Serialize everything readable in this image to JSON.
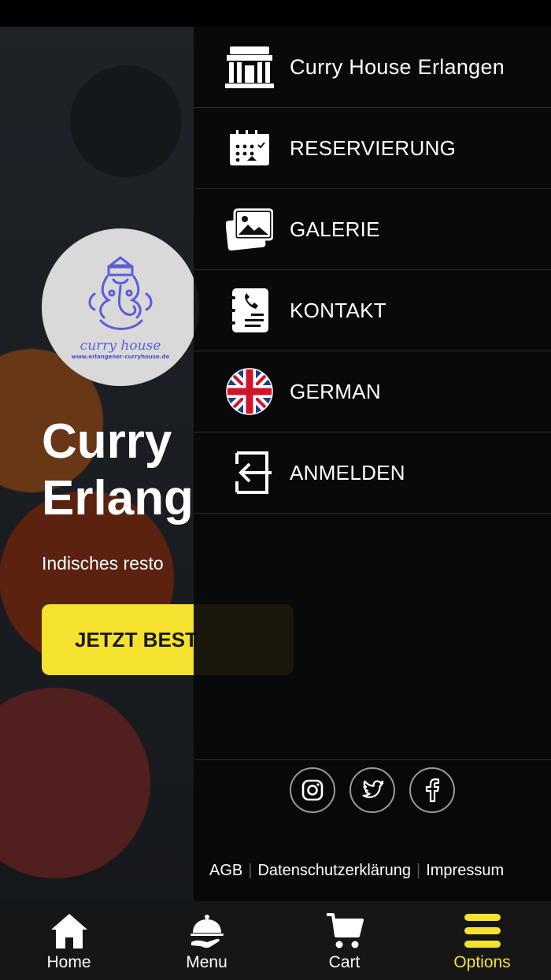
{
  "hero": {
    "title_line1": "Curry",
    "title_line2": "Erlang",
    "subtitle": "Indisches resto",
    "order_button": "JETZT BEST",
    "logo_text": "curry house",
    "logo_url": "www.erlangener-curryhouse.de"
  },
  "drawer": {
    "items": [
      {
        "label": "Curry House Erlangen",
        "icon": "restaurant-icon"
      },
      {
        "label": "RESERVIERUNG",
        "icon": "calendar-icon"
      },
      {
        "label": "GALERIE",
        "icon": "gallery-icon"
      },
      {
        "label": "KONTAKT",
        "icon": "contact-icon"
      },
      {
        "label": "GERMAN",
        "icon": "uk-flag-icon"
      },
      {
        "label": "ANMELDEN",
        "icon": "login-icon"
      }
    ],
    "social": [
      "instagram-icon",
      "twitter-icon",
      "facebook-icon"
    ],
    "footer": {
      "agb": "AGB",
      "privacy": "Datenschutzerklärung",
      "imprint": "Impressum"
    }
  },
  "bottom_nav": [
    {
      "label": "Home",
      "icon": "home-icon"
    },
    {
      "label": "Menu",
      "icon": "cloche-icon"
    },
    {
      "label": "Cart",
      "icon": "cart-icon"
    },
    {
      "label": "Options",
      "icon": "hamburger-icon",
      "active": true
    }
  ],
  "colors": {
    "accent": "#f5e22e",
    "drawer_bg": "#080808",
    "nav_bg": "#161616"
  }
}
